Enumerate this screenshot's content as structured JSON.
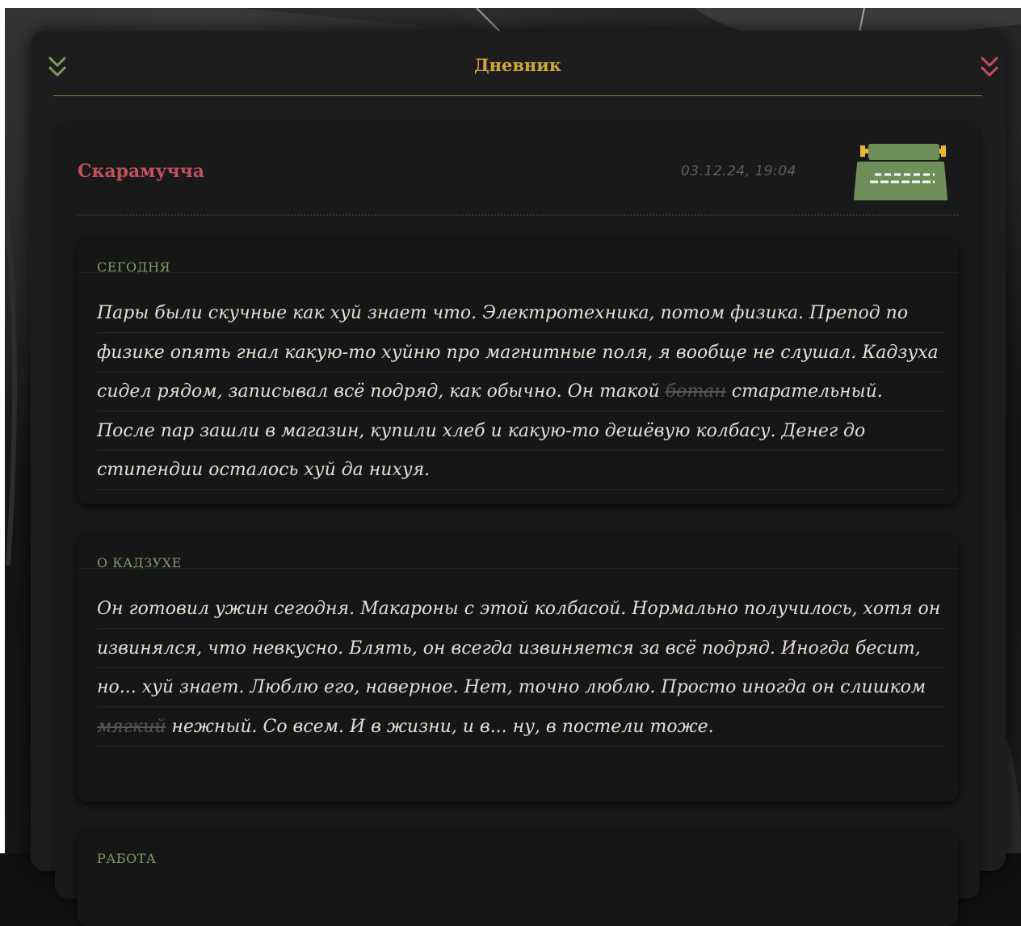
{
  "panel": {
    "title": "Дневник"
  },
  "entry": {
    "author": "Скарамучча",
    "date": "03.12.24, 19:04"
  },
  "sections": [
    {
      "title": "СЕГОДНЯ",
      "text_before": "Пары были скучные как хуй знает что. Электротехника, потом физика. Препод по физике опять гнал какую-то хуйню про магнитные поля, я вообще не слушал. Кадзуха сидел рядом, записывал всё подряд, как обычно. Он такой ",
      "struck": "ботан",
      "text_after": " старательный. После пар зашли в магазин, купили хлеб и какую-то дешёвую колбасу. Денег до стипендии осталось хуй да нихуя."
    },
    {
      "title": "О КАДЗУХЕ",
      "text_before": "Он готовил ужин сегодня. Макароны с этой колбасой. Нормально получилось, хотя он извинялся, что невкусно. Блять, он всегда извиняется за всё подряд. Иногда бесит, но... хуй знает. Люблю его, наверное. Нет, точно люблю. Просто иногда он слишком ",
      "struck": "мягкий",
      "text_after": " нежный. Со всем. И в жизни, и в... ну, в постели тоже."
    },
    {
      "title": "РАБОТА"
    }
  ],
  "colors": {
    "title": "#d2a63a",
    "author": "#c2505a",
    "section_title": "#7e9c62",
    "chevron_left": "#7e9c62",
    "chevron_right": "#c2505a",
    "typewriter": "#6e8f5a"
  },
  "icons": {
    "collapse_left": "chevrons-down-icon",
    "collapse_right": "chevrons-down-icon",
    "typewriter": "typewriter-icon"
  }
}
